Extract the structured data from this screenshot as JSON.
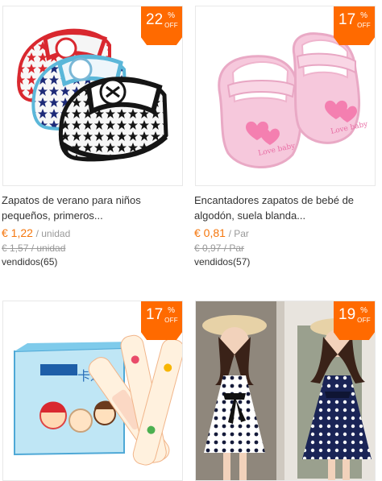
{
  "products": [
    {
      "discount": "22",
      "percent_sign": "%",
      "off_label": "OFF",
      "title_line1": "Zapatos de verano para niños",
      "title_line2": "pequeños, primeros...",
      "price": "€ 1,22",
      "unit": "/ unidad",
      "old_price": "€ 1,57 / unidad",
      "sold": "vendidos(65)",
      "image": "baby-star-sneakers"
    },
    {
      "discount": "17",
      "percent_sign": "%",
      "off_label": "OFF",
      "title_line1": "Encantadores zapatos de bebé de",
      "title_line2": "algodón, suela blanda...",
      "price": "€ 0,81",
      "unit": "/ Par",
      "old_price": "€ 0,97 / Par",
      "sold": "vendidos(57)",
      "image": "pink-baby-shoes",
      "image_text": "Love baby"
    },
    {
      "discount": "17",
      "percent_sign": "%",
      "off_label": "OFF",
      "image": "cartoon-bandage-box",
      "image_text": "卡通创"
    },
    {
      "discount": "19",
      "percent_sign": "%",
      "off_label": "OFF",
      "image": "girls-polka-dot-dresses"
    }
  ],
  "colors": {
    "badge": "#ff6a00",
    "price": "#f5760c",
    "border": "#e8e8e8"
  }
}
